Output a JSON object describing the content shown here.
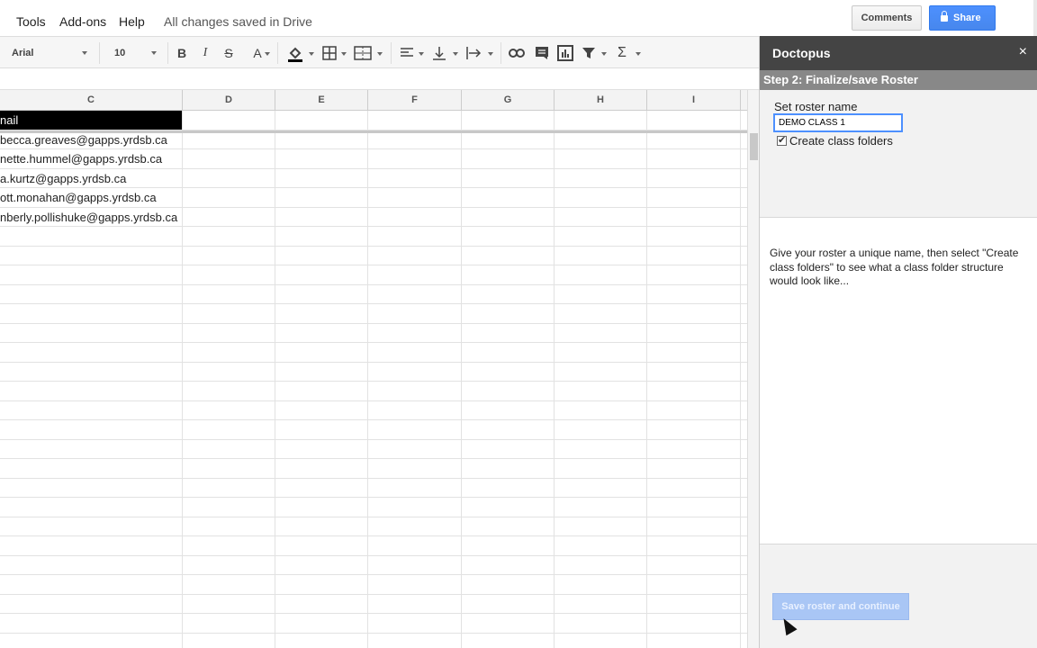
{
  "menubar": {
    "items": [
      "Tools",
      "Add-ons",
      "Help"
    ],
    "status": "All changes saved in Drive",
    "comments_label": "Comments",
    "share_label": "Share"
  },
  "toolbar": {
    "font": "Arial",
    "size": "10",
    "bold": "B",
    "italic": "I",
    "strike": "S",
    "text_color": "A",
    "sigma": "Σ"
  },
  "grid": {
    "columns": [
      "C",
      "D",
      "E",
      "F",
      "G",
      "H",
      "I"
    ],
    "header_cell": "nail",
    "emails": [
      "becca.greaves@gapps.yrdsb.ca",
      "nette.hummel@gapps.yrdsb.ca",
      "a.kurtz@gapps.yrdsb.ca",
      "ott.monahan@gapps.yrdsb.ca",
      "nberly.pollishuke@gapps.yrdsb.ca"
    ]
  },
  "panel": {
    "title": "Doctopus",
    "close": "×",
    "step": "Step 2: Finalize/save Roster",
    "roster_label": "Set roster name",
    "roster_value": "DEMO CLASS 1",
    "checkbox_label": "Create class folders",
    "description": "Give your roster a unique name, then select \"Create class folders\" to see what a class folder structure would look like...",
    "save_button": "Save roster and continue"
  },
  "colors": {
    "share_blue": "#4d90fe",
    "panel_header": "#444444",
    "step_bar": "#888888"
  }
}
